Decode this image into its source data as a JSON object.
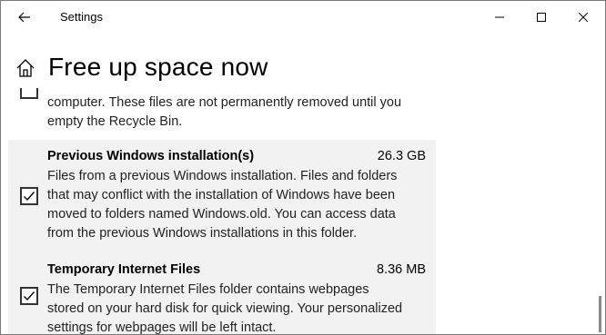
{
  "window": {
    "title": "Settings",
    "controls": {
      "minimize": "minimize",
      "maximize": "maximize",
      "close": "close"
    }
  },
  "header": {
    "title": "Free up space now"
  },
  "items": [
    {
      "name": "",
      "size": "",
      "checked": false,
      "description_lines": [
        "computer. These files are not permanently removed until you",
        "empty the Recycle Bin."
      ]
    },
    {
      "name": "Previous Windows installation(s)",
      "size": "26.3 GB",
      "checked": true,
      "description_lines": [
        "Files from a previous Windows installation.  Files and folders",
        "that may conflict with the installation of Windows have been",
        "moved to folders named Windows.old.  You can access data",
        "from the previous Windows installations in this folder."
      ]
    },
    {
      "name": "Temporary Internet Files",
      "size": "8.36 MB",
      "checked": true,
      "description_lines": [
        "The Temporary Internet Files folder contains webpages",
        "stored on your hard disk for quick viewing. Your personalized",
        "settings for webpages will be left intact."
      ]
    }
  ],
  "icons": {
    "back": "arrow-left-icon",
    "home": "home-icon",
    "minimize": "minimize-icon",
    "maximize": "maximize-icon",
    "close": "close-icon",
    "check": "checkmark-icon"
  },
  "colors": {
    "selected_background": "#f2f2f2",
    "text": "#000000",
    "description_text": "#222222"
  }
}
